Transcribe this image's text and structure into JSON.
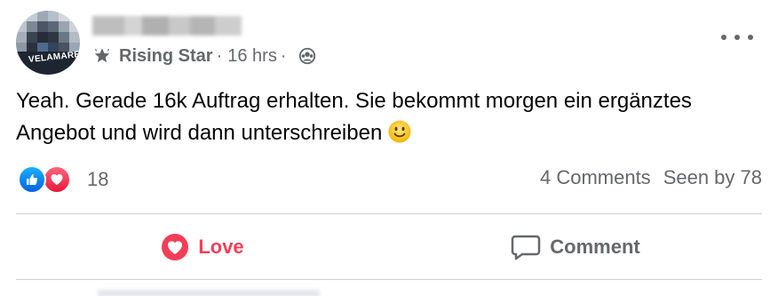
{
  "post": {
    "author": {
      "avatar_text": "VELAMARE"
    },
    "badge": {
      "label": "Rising Star",
      "icon": "rising-star-icon"
    },
    "separator_1": "·",
    "time": "16 hrs",
    "separator_2": "·",
    "audience_icon": "group-audience-icon",
    "more_icon": "more-options-icon",
    "text": "Yeah. Gerade 16k Auftrag erhalten. Sie bekommt morgen ein ergänztes Angebot und wird dann unterschreiben",
    "text_emoji": "smiling-face-emoji"
  },
  "reactions": {
    "types": [
      "like",
      "love"
    ],
    "count": "18"
  },
  "stats": {
    "comments": "4 Comments",
    "seen_by": "Seen by 78"
  },
  "actions": {
    "love_label": "Love",
    "comment_label": "Comment"
  },
  "colors": {
    "love": "#f33e58",
    "like_blue": "#1877f2",
    "secondary_text": "#65676b",
    "divider": "#ced0d4"
  }
}
